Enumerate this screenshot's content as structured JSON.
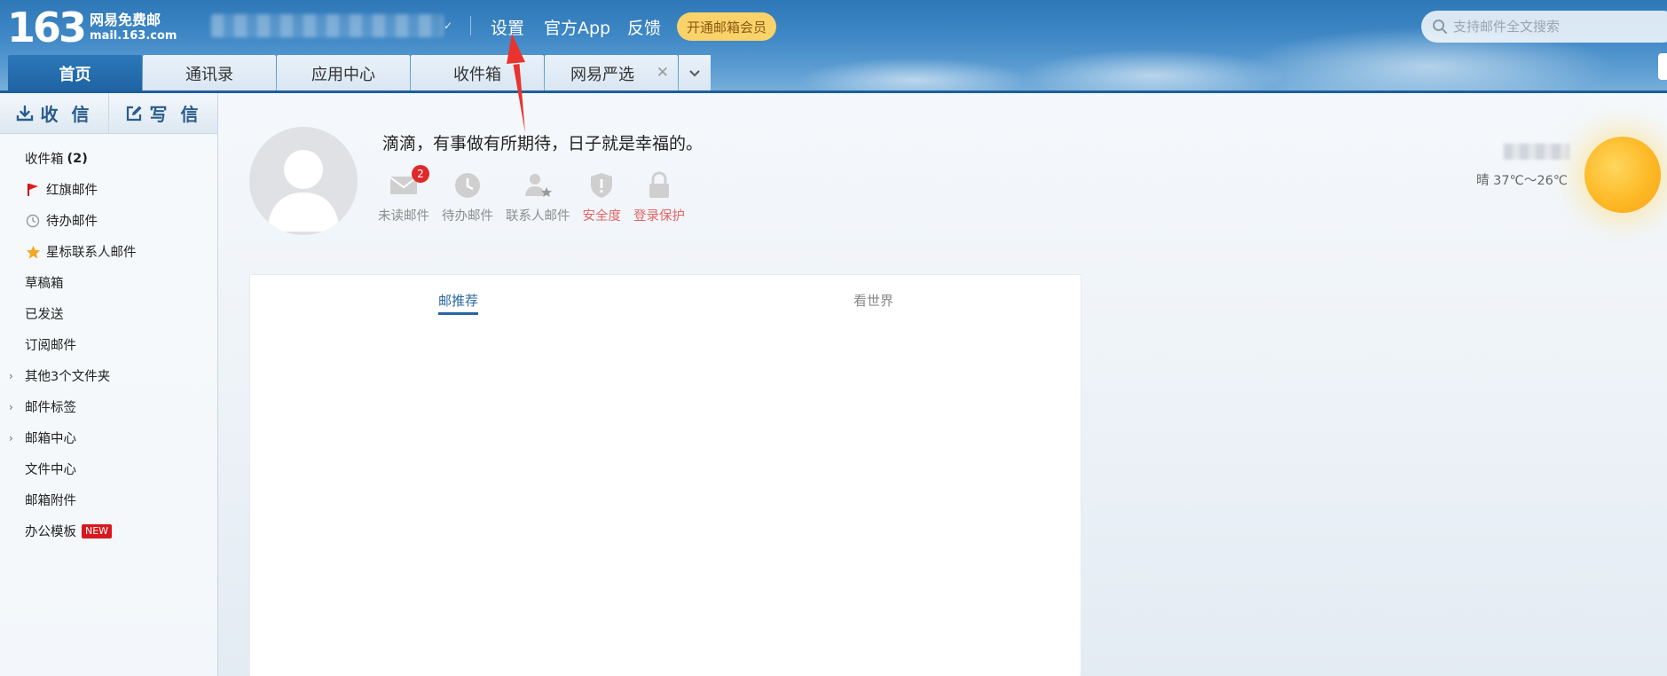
{
  "header": {
    "logo_number": "163",
    "logo_cn": "网易免费邮",
    "logo_en": "mail.163.com",
    "links": {
      "settings": "设置",
      "app": "官方App",
      "feedback": "反馈"
    },
    "vip_button": "开通邮箱会员",
    "search_placeholder": "支持邮件全文搜索"
  },
  "tabs": [
    {
      "label": "首页",
      "active": true
    },
    {
      "label": "通讯录"
    },
    {
      "label": "应用中心"
    },
    {
      "label": "收件箱"
    },
    {
      "label": "网易严选",
      "closable": true
    }
  ],
  "sidebar": {
    "receive": "收 信",
    "write": "写 信",
    "folders": [
      {
        "label": "收件箱",
        "count": "(2)"
      },
      {
        "label": "红旗邮件",
        "icon": "red-flag-icon"
      },
      {
        "label": "待办邮件",
        "icon": "clock-icon"
      },
      {
        "label": "星标联系人邮件",
        "icon": "star-icon"
      },
      {
        "label": "草稿箱"
      },
      {
        "label": "已发送"
      },
      {
        "label": "订阅邮件"
      },
      {
        "label": "其他3个文件夹",
        "expandable": true
      },
      {
        "label": "邮件标签",
        "expandable": true
      },
      {
        "label": "邮箱中心",
        "expandable": true
      },
      {
        "label": "文件中心"
      },
      {
        "label": "邮箱附件"
      },
      {
        "label": "办公模板",
        "badge": "NEW"
      }
    ]
  },
  "main": {
    "greeting": "滴滴，有事做有所期待，日子就是幸福的。",
    "stats": {
      "unread": {
        "label": "未读邮件",
        "badge": "2"
      },
      "todo": {
        "label": "待办邮件"
      },
      "contacts": {
        "label": "联系人邮件"
      },
      "security": {
        "label": "安全度"
      },
      "login": {
        "label": "登录保护"
      }
    },
    "feed_tabs": {
      "recommend": "邮推荐",
      "world": "看世界"
    },
    "weather": "晴 37℃～26℃"
  },
  "colors": {
    "header_blue": "#2f78b8",
    "active_tab": "#1f63a3",
    "vip_yellow": "#f9d36a",
    "badge_red": "#e02a2a",
    "annotation_red": "#e8332e"
  }
}
